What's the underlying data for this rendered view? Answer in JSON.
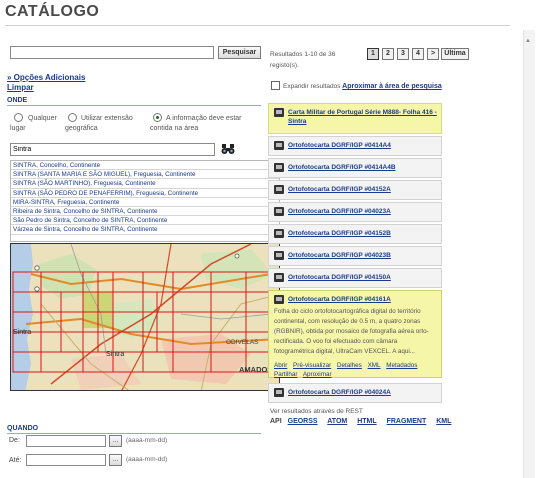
{
  "header": {
    "title": "CATÁLOGO"
  },
  "search": {
    "value": "",
    "button": "Pesquisar"
  },
  "left": {
    "advanced_options": "» Opções Adicionais",
    "clear": "Limpar",
    "where_label": "ONDE",
    "radios": [
      {
        "label": "Qualquer lugar",
        "selected": false
      },
      {
        "label": "Utilizar extensão geográfica",
        "selected": false
      },
      {
        "label": "A informação deve estar contida na área",
        "selected": true
      }
    ],
    "place_value": "Sintra",
    "places": [
      "SINTRA, Concelho, Continente",
      "SINTRA (SANTA MARIA E SÃO MIGUEL), Freguesia, Continente",
      "SINTRA (SÃO MARTINHO), Freguesia, Continente",
      "SINTRA (SÃO PEDRO DE PENAFERRIM), Freguesia, Continente",
      "MIRA-SINTRA, Freguesia, Continente",
      "Ribeira de Sintra, Concelho de SINTRA, Continente",
      "São Pedro de Sintra, Concelho de SINTRA, Continente",
      "Várzea de Sintra, Concelho de SINTRA, Continente"
    ],
    "map_labels": [
      {
        "text": "Sintra",
        "kind": "town"
      },
      {
        "text": "Sintra",
        "kind": "town"
      },
      {
        "text": "AMADORA",
        "kind": "city"
      },
      {
        "text": "ODIVELAS",
        "kind": "city"
      }
    ],
    "when_label": "QUANDO",
    "from_label": "De:",
    "to_label": "Até:",
    "date_button": "...",
    "date_hint": "(aaaa-mm-dd)"
  },
  "results": {
    "summary": "Resultados 1-10 de 36 registo(s).",
    "pages": [
      "1",
      "2",
      "3",
      "4",
      ">",
      "Última"
    ],
    "current_page": "1",
    "expand_label": "Expandir resultados",
    "zoom_search": "Aproximar à área de pesquisa",
    "items": [
      {
        "title": "Carta Militar de Portugal Série M888- Folha 416 - Sintra",
        "style": "highlight"
      },
      {
        "title": "Ortofotocarta DGRF/IGP #0414A4",
        "style": "normal"
      },
      {
        "title": "Ortofotocarta DGRF/IGP #0414A4B",
        "style": "normal"
      },
      {
        "title": "Ortofotocarta DGRF/IGP #04152A",
        "style": "normal"
      },
      {
        "title": "Ortofotocarta DGRF/IGP #04023A",
        "style": "normal"
      },
      {
        "title": "Ortofotocarta DGRF/IGP #04152B",
        "style": "normal"
      },
      {
        "title": "Ortofotocarta DGRF/IGP #04023B",
        "style": "normal"
      },
      {
        "title": "Ortofotocarta DGRF/IGP #04150A",
        "style": "normal"
      },
      {
        "title": "Ortofotocarta DGRF/IGP #04161A",
        "style": "open"
      },
      {
        "title": "Ortofotocarta DGRF/IGP #04024A",
        "style": "normal"
      }
    ],
    "open_description": "Folha do ciclo ortofotocartográfica digital do território continental, com resolução de 0.5 m, a quatro zonas (RGBNIR), obtida por mosaico de fotografia aérea orto-rectificada. O voo foi efectuado com câmara fotogramétrica digital, UltraCam VEXCEL. A aqui...",
    "open_actions": [
      "Abrir",
      "Pré-visualizar",
      "Detalhes",
      "XML",
      "Metadados",
      "Partilhar",
      "Aproximar"
    ],
    "rest_text": "Ver resultados através de REST",
    "api_label": "API",
    "formats": [
      "GEORSS",
      "ATOM",
      "HTML",
      "FRAGMENT",
      "KML"
    ]
  },
  "colors": {
    "link": "#1a3a8c",
    "highlight": "#f6f6a9",
    "map_grid": "#d81818"
  }
}
